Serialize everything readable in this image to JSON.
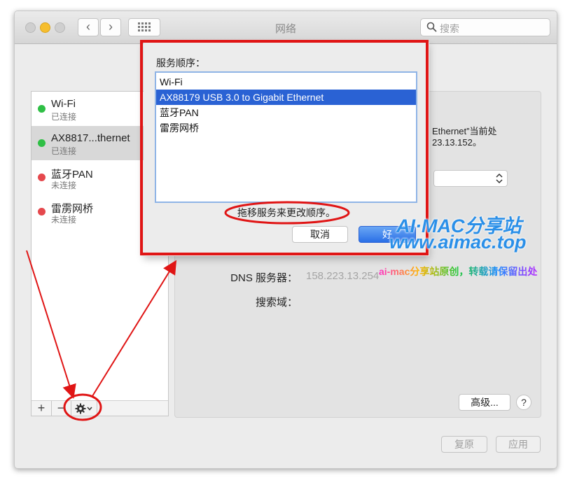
{
  "window": {
    "title": "网络"
  },
  "search": {
    "placeholder": "搜索"
  },
  "services": [
    {
      "name": "Wi-Fi",
      "status": "已连接",
      "color": "#2fbf45"
    },
    {
      "name": "AX8817...thernet",
      "status": "已连接",
      "color": "#2fbf45"
    },
    {
      "name": "蓝牙PAN",
      "status": "未连接",
      "color": "#e5484d"
    },
    {
      "name": "雷雳网桥",
      "status": "未连接",
      "color": "#e5484d"
    }
  ],
  "service_tools": {
    "add": "+",
    "remove": "−",
    "gear_icon": "gear-icon"
  },
  "detail": {
    "status_fragment_1": "Ethernet”当前处",
    "status_fragment_2": "23.13.152。",
    "dns_label": "DNS 服务器：",
    "dns_value": "158.223.13.254",
    "search_domain_label": "搜索域：",
    "advanced_button": "高级...",
    "help_button": "?"
  },
  "footer": {
    "revert_button": "复原",
    "apply_button": "应用"
  },
  "sheet": {
    "title": "服务顺序：",
    "order": [
      "Wi-Fi",
      "AX88179 USB 3.0 to Gigabit Ethernet",
      "蓝牙PAN",
      "雷雳网桥"
    ],
    "selected_index": 1,
    "hint": "拖移服务来更改顺序。",
    "cancel_button": "取消",
    "ok_button": "好"
  },
  "watermark": {
    "line1": "AI·MAC分享站",
    "line2": "www.aimac.top",
    "line3": "ai-mac分享站原创，转载请保留出处"
  },
  "colors": {
    "annotation": "#e01515",
    "selection": "#2a62d4",
    "watermark": "#2a8fe8"
  }
}
